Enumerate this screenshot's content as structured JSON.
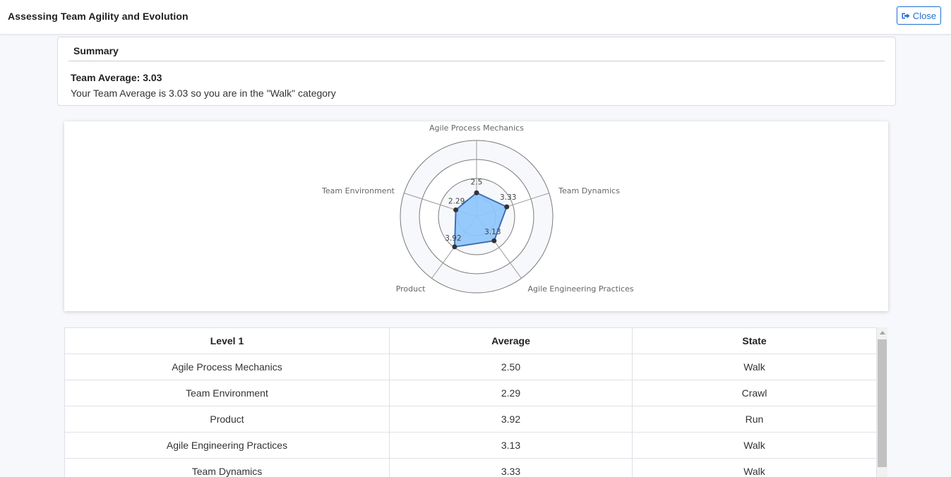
{
  "header": {
    "title": "Assessing Team Agility and Evolution",
    "close_label": "Close",
    "close_icon": "sign-out-icon"
  },
  "summary": {
    "heading": "Summary",
    "average_label": "Team Average: 3.03",
    "message": "Your Team Average is 3.03 so you are in the \"Walk\" category"
  },
  "chart_data": {
    "type": "radar",
    "axes": [
      "Agile Process Mechanics",
      "Team Dynamics",
      "Agile Engineering Practices",
      "Product",
      "Team Environment"
    ],
    "values": [
      2.5,
      3.33,
      3.13,
      3.92,
      2.29
    ],
    "value_labels": [
      "2.5",
      "3.33",
      "3.13",
      "3.92",
      "2.29"
    ],
    "range": [
      0,
      8
    ],
    "rings": 4,
    "fill_color": "#8ec5fc",
    "line_color": "#3f6fb5",
    "point_color": "#333333"
  },
  "table": {
    "headers": [
      "Level 1",
      "Average",
      "State"
    ],
    "rows": [
      [
        "Agile Process Mechanics",
        "2.50",
        "Walk"
      ],
      [
        "Team Environment",
        "2.29",
        "Crawl"
      ],
      [
        "Product",
        "3.92",
        "Run"
      ],
      [
        "Agile Engineering Practices",
        "3.13",
        "Walk"
      ],
      [
        "Team Dynamics",
        "3.33",
        "Walk"
      ]
    ]
  }
}
